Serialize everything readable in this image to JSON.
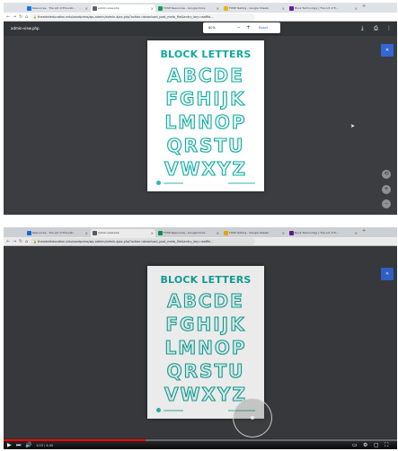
{
  "colors": {
    "title_teal": "#13a89e",
    "letter_outline": "#16a89c",
    "letter_fill": "#e8fbf9",
    "viewer_bg": "#3b3d40",
    "pdf_header": "#323639",
    "side_button": "#3367d6",
    "video_progress": "#ff0000"
  },
  "browser": {
    "tabs": [
      {
        "label": "Resources - The Art of Educati..."
      },
      {
        "label": "admin-view.php"
      },
      {
        "label": "FUSE Resources - Google Drive"
      },
      {
        "label": "FUSE Testing - Google Sheets"
      },
      {
        "label": "Book Technology | The Art of E..."
      }
    ],
    "address": "theartofeducation.edu/wordpress/wp-admin/admin-ajax.php?action=download_post_meta_file&entry_key=waffle...",
    "nav_icons": [
      "back-icon",
      "forward-icon",
      "reload-icon",
      "home-icon"
    ]
  },
  "pdf": {
    "filename": "admin-view.php",
    "zoom_value": "80%",
    "zoom_minus": "–",
    "zoom_plus": "+",
    "zoom_reset": "Reset",
    "header_icons": [
      "download-icon",
      "print-icon",
      "more-icon"
    ]
  },
  "worksheet": {
    "title": "BLOCK LETTERS",
    "rows": [
      "ABCDE",
      "FGHIJK",
      "LMNOP",
      "QRSTU",
      "VWXYZ"
    ]
  },
  "video": {
    "progress_percent": 36,
    "time": "1:03 / 4:45"
  }
}
